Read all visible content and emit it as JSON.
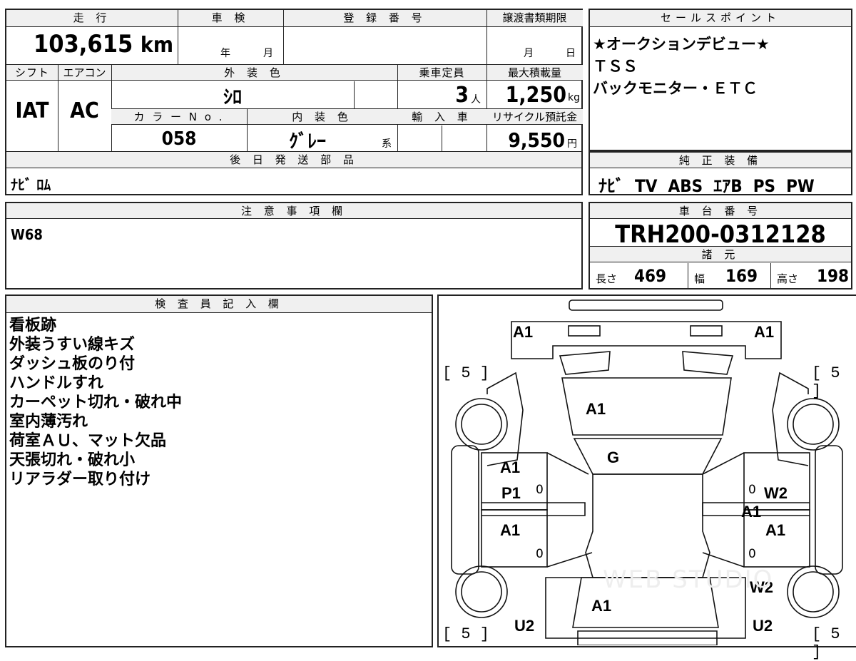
{
  "vehicle": {
    "mileage_header": "走 行",
    "mileage": "103,615",
    "mileage_unit": "km",
    "inspection_header": "車 検",
    "inspection_year": "年",
    "inspection_month": "月",
    "registration_header": "登 録 番 号",
    "transfer_header": "譲渡書類期限",
    "transfer_month": "月",
    "transfer_day": "日",
    "shift_header": "シフト",
    "shift": "IAT",
    "ac_header": "エアコン",
    "ac": "AC",
    "exterior_header": "外 装 色",
    "exterior_color": "ｼﾛ",
    "capacity_header": "乗車定員",
    "capacity": "3",
    "capacity_unit": "人",
    "max_load_header": "最大積載量",
    "max_load": "1,250",
    "max_load_unit": "kg",
    "color_no_header": "カ ラ ー N o .",
    "color_no": "058",
    "interior_header": "内 装 色",
    "interior_color": "ｸﾞﾚｰ",
    "interior_suffix": "系",
    "import_header": "輸 入 車",
    "recycle_header": "リサイクル預託金",
    "recycle_fee": "9,550",
    "recycle_unit": "円",
    "parts_header": "後 日 発 送 部 品",
    "parts": "ﾅﾋﾞ ﾛﾑ"
  },
  "sales_points": {
    "header": "セールスポイント",
    "lines": [
      "★オークションデビュー★",
      "ＴＳＳ",
      "バックモニター・ＥＴＣ"
    ]
  },
  "equipment": {
    "header": "純 正 装 備",
    "value": "ﾅﾋﾞ  TV  ABS  ｴｱB  PS  PW"
  },
  "notes": {
    "header": "注 意 事 項 欄",
    "value": "W68"
  },
  "chassis": {
    "header": "車 台 番 号",
    "number": "TRH200-0312128",
    "spec_header": "諸 元",
    "length_label": "長さ",
    "length": "469",
    "width_label": "幅",
    "width": "169",
    "height_label": "高さ",
    "height": "198"
  },
  "inspector": {
    "header": "検 査 員 記 入 欄",
    "lines": [
      "看板跡",
      "外装うすい線キズ",
      "ダッシュ板のり付",
      "ハンドルすれ",
      "カーペット切れ・破れ中",
      "室内薄汚れ",
      "荷室ＡＵ、マット欠品",
      "天張切れ・破れ小",
      "リアラダー取り付け"
    ]
  },
  "diagram": {
    "tire_marks": [
      "[ 5 ]",
      "[ 5 ]",
      "[ 5 ]",
      "[ 5 ]"
    ],
    "front_left": "A1",
    "front_right": "A1",
    "hood": "A1",
    "windshield": "G",
    "left_front_door": "A1",
    "left_front_door_2": "P1",
    "left_rear_door": "A1",
    "right_front_door": "W2",
    "right_middle": "A1",
    "right_rear_door": "A1",
    "right_rear_panel": "W2",
    "roof_rear": "A1",
    "rear_left": "U2",
    "rear_right": "U2",
    "zero_marks": [
      "0",
      "0",
      "0",
      "0"
    ],
    "watermark": "WEB STUDIO"
  }
}
